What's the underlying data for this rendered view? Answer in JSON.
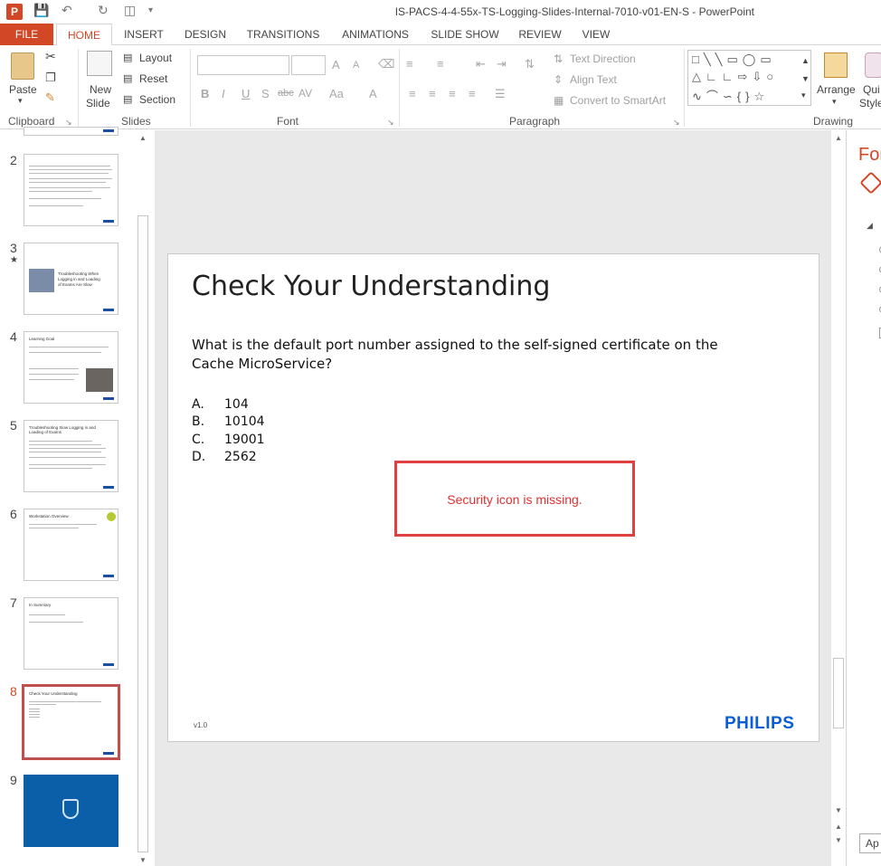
{
  "window": {
    "title": "IS-PACS-4-4-55x-TS-Logging-Slides-Internal-7010-v01-EN-S - PowerPoint",
    "app_icon_letter": "P"
  },
  "tabs": [
    "FILE",
    "HOME",
    "INSERT",
    "DESIGN",
    "TRANSITIONS",
    "ANIMATIONS",
    "SLIDE SHOW",
    "REVIEW",
    "VIEW"
  ],
  "active_tab": "HOME",
  "ribbon": {
    "clipboard": {
      "paste": "Paste",
      "label": "Clipboard"
    },
    "slides": {
      "new_slide_1": "New",
      "new_slide_2": "Slide",
      "layout": "Layout",
      "reset": "Reset",
      "section": "Section",
      "label": "Slides"
    },
    "font": {
      "label": "Font",
      "bold": "B",
      "italic": "I",
      "underline": "U",
      "shadow": "S",
      "strike": "abc",
      "spacing": "AV",
      "case": "Aa",
      "color": "A",
      "grow": "A",
      "shrink": "A"
    },
    "paragraph": {
      "label": "Paragraph",
      "text_direction": "Text Direction",
      "align_text": "Align Text",
      "convert_smartart": "Convert to SmartArt"
    },
    "drawing": {
      "label": "Drawing",
      "arrange": "Arrange",
      "quick_styles_1": "Qui",
      "quick_styles_2": "Style"
    }
  },
  "thumbnails": [
    {
      "num": "2",
      "title": ""
    },
    {
      "num": "3",
      "title": "Troubleshooting When Logging in and Loading of Exams Are Slow"
    },
    {
      "num": "4",
      "title": "Learning Goal"
    },
    {
      "num": "5",
      "title": "Troubleshooting Slow Logging in and Loading of Exams"
    },
    {
      "num": "6",
      "title": "Workstation Overview"
    },
    {
      "num": "7",
      "title": "In Summary"
    },
    {
      "num": "8",
      "title": "Check Your Understanding"
    },
    {
      "num": "9",
      "title": ""
    }
  ],
  "slide": {
    "title": "Check Your Understanding",
    "question": "What is the default port number assigned to the self-signed certificate on the Cache MicroService?",
    "options": [
      {
        "letter": "A.",
        "value": "104"
      },
      {
        "letter": "B.",
        "value": "10104"
      },
      {
        "letter": "C.",
        "value": "19001"
      },
      {
        "letter": "D.",
        "value": "2562"
      }
    ],
    "alert": "Security icon is missing.",
    "version": "v1.0",
    "logo": "PHILIPS"
  },
  "format_pane": {
    "title": "For",
    "apply_button": "Ap"
  },
  "colors": {
    "accent": "#d24726",
    "alert": "#e04040",
    "philips_blue": "#0b5ed7"
  }
}
